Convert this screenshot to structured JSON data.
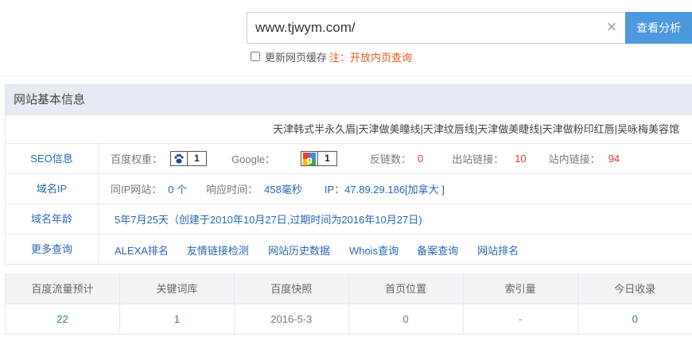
{
  "search": {
    "value": "www.tjwym.com/",
    "button_label": "查看分析",
    "cache_label": "更新网页缓存",
    "note_label": "注：开放内页查询"
  },
  "panel": {
    "title": "网站基本信息",
    "site_title": "天津韩式半永久眉|天津做美瞳线|天津纹唇线|天津做美睫线|天津做粉印红唇|吴咏梅美容馆"
  },
  "seo": {
    "label": "SEO信息",
    "baidu_label": "百度权重：",
    "baidu_value": "1",
    "google_label": "Google：",
    "google_value": "1",
    "backlinks_label": "反链数：",
    "backlinks_value": "0",
    "outlinks_label": "出站链接：",
    "outlinks_value": "10",
    "inlinks_label": "站内链接：",
    "inlinks_value": "94"
  },
  "domain_ip": {
    "label": "域名IP",
    "same_ip_label": "同IP网站：",
    "same_ip_value": "0 个",
    "response_label": "响应时间：",
    "response_value": "458毫秒",
    "ip_value": "IP：47.89.29.186[加拿大 ]"
  },
  "domain_age": {
    "label": "域名年龄",
    "value": "5年7月25天（创建于2010年10月27日,过期时间为2016年10月27日)"
  },
  "more": {
    "label": "更多查询",
    "links": [
      "ALEXA排名",
      "友情链接检测",
      "网站历史数据",
      "Whois查询",
      "备案查询",
      "网站排名"
    ]
  },
  "stats": {
    "headers": [
      "百度流量预计",
      "关键词库",
      "百度快照",
      "首页位置",
      "索引量",
      "今日收录"
    ],
    "values": [
      "22",
      "1",
      "2016-5-3",
      "0",
      "-",
      "0"
    ]
  },
  "colors": {
    "accent": "#4c99e0",
    "label_blue": "#2a67b1",
    "value_red": "#d9362e",
    "value_green": "#2e8b3a",
    "note_orange": "#e0581d"
  }
}
